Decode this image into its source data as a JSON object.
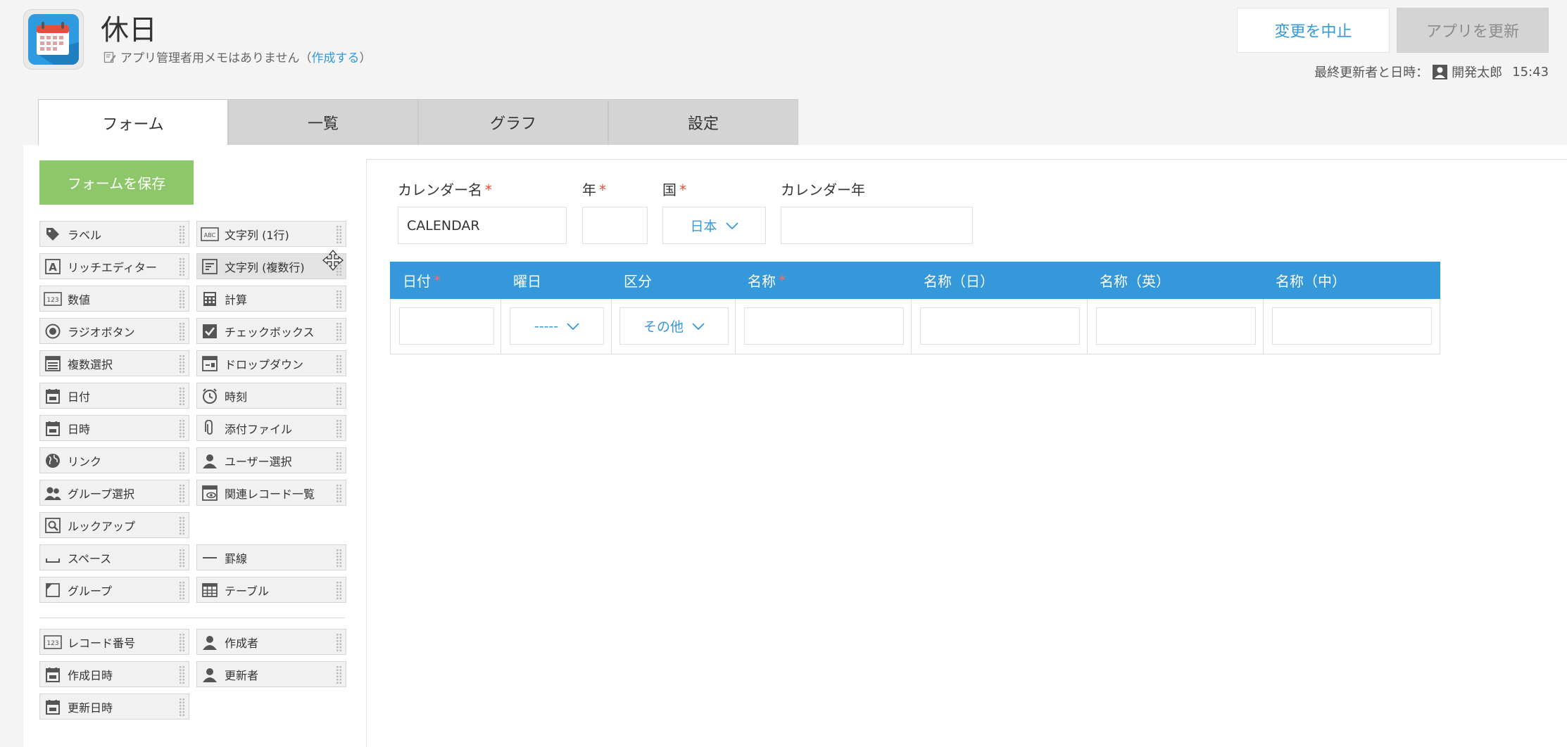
{
  "app": {
    "title": "休日"
  },
  "memo": {
    "text": "アプリ管理者用メモはありません（",
    "link": "作成する",
    "close": "）"
  },
  "header": {
    "cancel_label": "変更を中止",
    "update_label": "アプリを更新",
    "last_updated_label": "最終更新者と日時：",
    "last_updated_user": "開発太郎",
    "last_updated_time": "15:43"
  },
  "tabs": [
    {
      "label": "フォーム",
      "active": true
    },
    {
      "label": "一覧",
      "active": false
    },
    {
      "label": "グラフ",
      "active": false
    },
    {
      "label": "設定",
      "active": false
    }
  ],
  "palette": {
    "save_label": "フォームを保存",
    "items": [
      {
        "label": "ラベル",
        "icon": "tag-icon"
      },
      {
        "label": "文字列 (1行)",
        "icon": "abc-icon"
      },
      {
        "label": "リッチエディター",
        "icon": "rich-text-icon"
      },
      {
        "label": "文字列 (複数行)",
        "icon": "multiline-text-icon"
      },
      {
        "label": "数値",
        "icon": "number-icon"
      },
      {
        "label": "計算",
        "icon": "calculator-icon"
      },
      {
        "label": "ラジオボタン",
        "icon": "radio-icon"
      },
      {
        "label": "チェックボックス",
        "icon": "checkbox-icon"
      },
      {
        "label": "複数選択",
        "icon": "multi-select-icon"
      },
      {
        "label": "ドロップダウン",
        "icon": "dropdown-icon"
      },
      {
        "label": "日付",
        "icon": "calendar-icon"
      },
      {
        "label": "時刻",
        "icon": "clock-icon"
      },
      {
        "label": "日時",
        "icon": "calendar-icon"
      },
      {
        "label": "添付ファイル",
        "icon": "paperclip-icon"
      },
      {
        "label": "リンク",
        "icon": "globe-icon"
      },
      {
        "label": "ユーザー選択",
        "icon": "user-icon"
      },
      {
        "label": "グループ選択",
        "icon": "group-icon"
      },
      {
        "label": "関連レコード一覧",
        "icon": "related-records-icon"
      },
      {
        "label": "ルックアップ",
        "icon": "lookup-icon"
      },
      {
        "label": "スペース",
        "icon": "space-icon"
      },
      {
        "label": "罫線",
        "icon": "line-icon"
      },
      {
        "label": "グループ",
        "icon": "group-folder-icon"
      },
      {
        "label": "テーブル",
        "icon": "table-icon"
      },
      {
        "label": "レコード番号",
        "icon": "number-icon"
      },
      {
        "label": "作成者",
        "icon": "user-icon"
      },
      {
        "label": "作成日時",
        "icon": "calendar-icon"
      },
      {
        "label": "更新者",
        "icon": "user-icon"
      },
      {
        "label": "更新日時",
        "icon": "calendar-icon"
      }
    ]
  },
  "form": {
    "calendar_name": {
      "label": "カレンダー名",
      "required": "*",
      "value": "CALENDAR"
    },
    "year": {
      "label": "年",
      "required": "*",
      "value": ""
    },
    "country": {
      "label": "国",
      "required": "*",
      "value": "日本"
    },
    "calendar_year": {
      "label": "カレンダー年",
      "value": ""
    }
  },
  "table": {
    "columns": [
      {
        "label": "日付",
        "required": "*"
      },
      {
        "label": "曜日",
        "required": ""
      },
      {
        "label": "区分",
        "required": ""
      },
      {
        "label": "名称",
        "required": "*"
      },
      {
        "label": "名称（日）",
        "required": ""
      },
      {
        "label": "名称（英）",
        "required": ""
      },
      {
        "label": "名称（中）",
        "required": ""
      }
    ],
    "weekday_value": "-----",
    "category_value": "その他"
  },
  "colors": {
    "accent": "#3498db",
    "save": "#8ec76a",
    "required": "#e74c3c"
  }
}
